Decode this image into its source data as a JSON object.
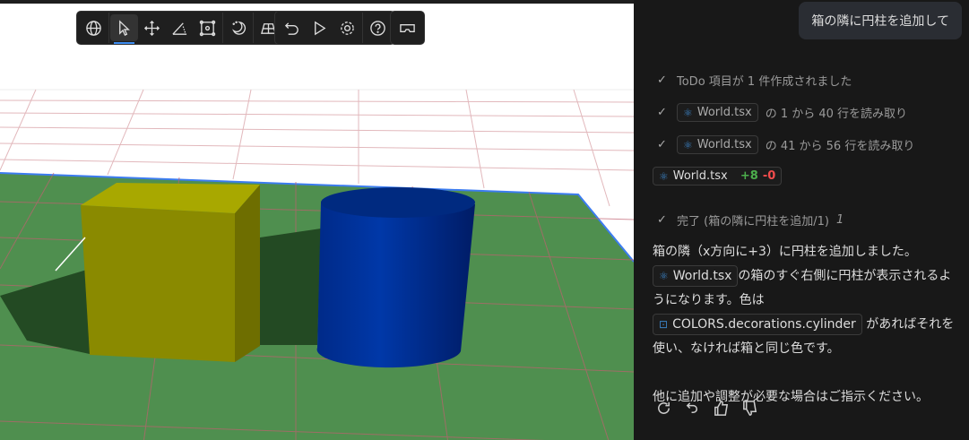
{
  "toolbar": {
    "groups": [
      [
        "globe-icon",
        "select-icon",
        "move-icon",
        "measure-icon",
        "transform-icon",
        "night-mode-icon",
        "grid-icon"
      ],
      [
        "undo-icon",
        "play-icon",
        "settings-icon",
        "help-icon"
      ],
      [
        "vr-icon"
      ]
    ],
    "active": "select-icon"
  },
  "scene": {
    "colors": {
      "ground": "#4f8f4f",
      "box": "#a3a300",
      "cylinder": "#00339a",
      "grid": "#d9a0a8",
      "edge": "#3c7cf0"
    }
  },
  "chat": {
    "user_message": "箱の隣に円柱を追加して",
    "steps": [
      {
        "text": "ToDo 項目が 1 件作成されました"
      },
      {
        "file": "World.tsx",
        "text": "の 1 から 40 行を読み取り"
      },
      {
        "file": "World.tsx",
        "text": "の 41 から 56 行を読み取り"
      }
    ],
    "diff": {
      "file": "World.tsx",
      "added": "+8",
      "removed": "-0"
    },
    "done": {
      "text": "完了 (箱の隣に円柱を追加/1)",
      "count": "1"
    },
    "message": {
      "p1": "箱の隣（x方向に+3）に円柱を追加しました。",
      "file": "World.tsx",
      "p2": "の箱のすぐ右側に円柱が表示されるようになります。色は",
      "symbol": "COLORS.decorations.cylinder",
      "p3": "があればそれを使い、なければ箱と同じ色です。",
      "p4": "他に追加や調整が必要な場合はご指示ください。"
    },
    "actions": [
      "retry-icon",
      "undo-icon",
      "thumbs-up-icon",
      "thumbs-down-icon"
    ]
  }
}
